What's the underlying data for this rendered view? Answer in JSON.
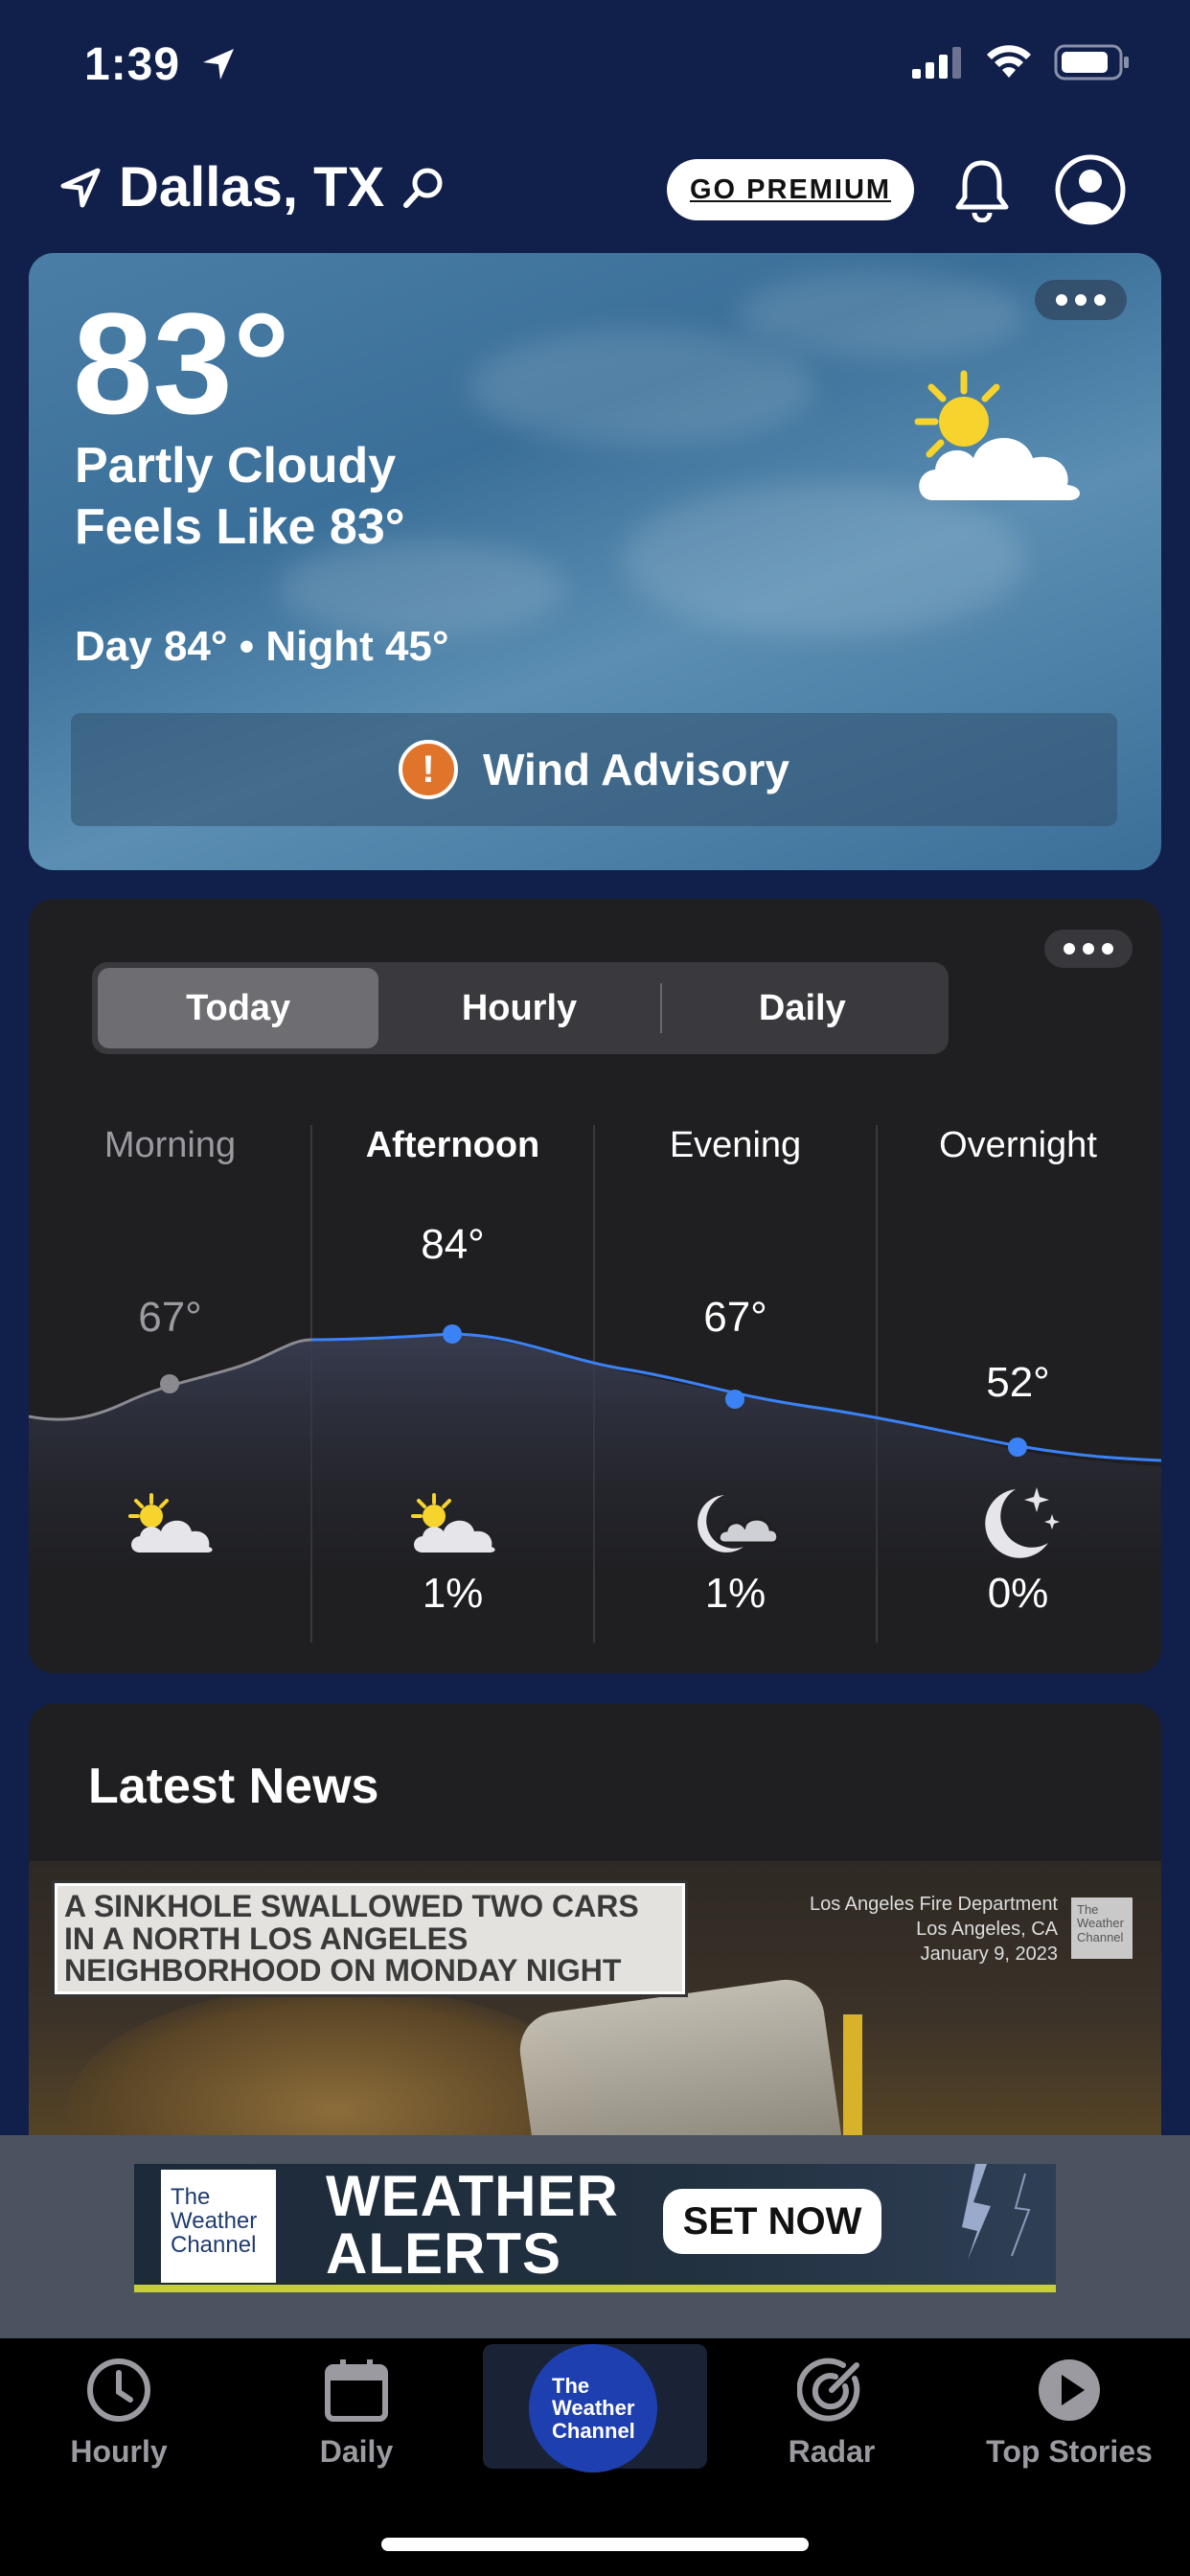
{
  "status_bar": {
    "time": "1:39"
  },
  "header": {
    "location": "Dallas, TX",
    "premium_label": "GO PREMIUM"
  },
  "current": {
    "temperature": "83°",
    "condition": "Partly Cloudy",
    "feels_like": "Feels Like 83°",
    "day_night": "Day 84° • Night 45°",
    "advisory": "Wind Advisory",
    "icon": "partly-cloudy-icon"
  },
  "forecast": {
    "tabs": [
      "Today",
      "Hourly",
      "Daily"
    ],
    "active_tab": "Today",
    "periods": [
      {
        "label": "Morning",
        "temp": "67°",
        "precip": "",
        "icon": "partly-cloudy-icon"
      },
      {
        "label": "Afternoon",
        "temp": "84°",
        "precip": "1%",
        "icon": "partly-cloudy-icon"
      },
      {
        "label": "Evening",
        "temp": "67°",
        "precip": "1%",
        "icon": "cloudy-night-icon"
      },
      {
        "label": "Overnight",
        "temp": "52°",
        "precip": "0%",
        "icon": "clear-night-icon"
      }
    ]
  },
  "news": {
    "title": "Latest News",
    "story": {
      "caption": "A SINKHOLE SWALLOWED TWO CARS IN A NORTH LOS ANGELES NEIGHBORHOOD ON MONDAY NIGHT",
      "credit_1": "Los Angeles Fire Department",
      "credit_2": "Los Angeles, CA",
      "credit_3": "January 9, 2023",
      "bug": "The Weather Channel"
    }
  },
  "ad": {
    "logo": "The Weather Channel",
    "headline_1": "WEATHER",
    "headline_2": "ALERTS",
    "button": "SET NOW"
  },
  "tabbar": {
    "items": [
      "Hourly",
      "Daily",
      "Radar",
      "Top Stories"
    ],
    "home_logo": "The Weather Channel"
  },
  "colors": {
    "background": "#11204a",
    "accent_blue": "#3b82f6",
    "advisory_orange": "#e0742a",
    "brand_blue": "#1e3fb0"
  }
}
